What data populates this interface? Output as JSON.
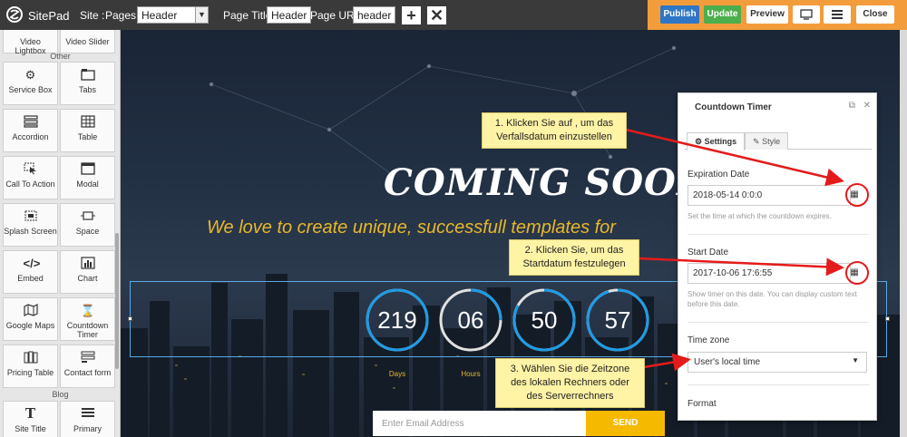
{
  "app": {
    "brand": "SitePad"
  },
  "toolbar": {
    "site_label": "Site :",
    "pages_label": "Pages :",
    "pages_value": "Header",
    "page_title_label": "Page Title:",
    "page_title_value": "Header",
    "page_url_label": "Page URL:",
    "page_url_value": "header",
    "add_icon": "plus-icon",
    "delete_icon": "close-icon",
    "publish": "Publish",
    "update": "Update",
    "preview": "Preview",
    "close": "Close",
    "accent": "#f39c3b"
  },
  "sidebar": {
    "top_partial": [
      "Video Lightbox",
      "Video Slider"
    ],
    "sections": [
      {
        "title": "Other",
        "items": [
          {
            "label": "Service Box",
            "icon": "gear-icon"
          },
          {
            "label": "Tabs",
            "icon": "tabs-icon"
          },
          {
            "label": "Accordion",
            "icon": "accordion-icon"
          },
          {
            "label": "Table",
            "icon": "table-icon"
          },
          {
            "label": "Call To Action",
            "icon": "cursor-icon"
          },
          {
            "label": "Modal",
            "icon": "modal-icon"
          },
          {
            "label": "Splash Screen",
            "icon": "splash-icon"
          },
          {
            "label": "Space",
            "icon": "space-icon"
          },
          {
            "label": "Embed",
            "icon": "code-icon"
          },
          {
            "label": "Chart",
            "icon": "chart-icon"
          },
          {
            "label": "Google Maps",
            "icon": "map-icon"
          },
          {
            "label": "Countdown Timer",
            "icon": "hourglass-icon"
          },
          {
            "label": "Pricing Table",
            "icon": "pricing-icon"
          },
          {
            "label": "Contact form",
            "icon": "form-icon"
          }
        ]
      },
      {
        "title": "Blog",
        "items": [
          {
            "label": "Site Title",
            "icon": "text-icon"
          },
          {
            "label": "Primary",
            "icon": "menu-icon"
          }
        ]
      }
    ]
  },
  "canvas": {
    "headline": "COMING SOON",
    "tagline": "We love to create unique, successfull templates for",
    "countdown": [
      {
        "value": "219",
        "label": "Days",
        "progress": 1.0
      },
      {
        "value": "06",
        "label": "Hours",
        "progress": 0.25
      },
      {
        "value": "50",
        "label": "",
        "progress": 0.83
      },
      {
        "value": "57",
        "label": "",
        "progress": 0.95
      }
    ],
    "email_placeholder": "Enter Email Address",
    "send_label": "SEND",
    "send_color": "#f5b900",
    "ring_color": "#1e9be6"
  },
  "panel": {
    "title": "Countdown Timer",
    "tabs": [
      "Settings",
      "Style"
    ],
    "expiration_label": "Expiration Date",
    "expiration_value": "2018-05-14 0:0:0",
    "expiration_help": "Set the time at which the countdown expires.",
    "start_label": "Start Date",
    "start_value": "2017-10-06 17:6:55",
    "start_help": "Show timer on this date. You can display custom text before this date.",
    "timezone_label": "Time zone",
    "timezone_value": "User's local time",
    "format_label": "Format"
  },
  "callouts": {
    "c1": "1. Klicken Sie auf , um das Verfallsdatum einzustellen",
    "c2": "2. Klicken Sie, um das Startdatum festzulegen",
    "c3": "3. Wählen Sie die Zeitzone des lokalen Rechners oder des Serverrechners",
    "color": "#e41b1b"
  }
}
